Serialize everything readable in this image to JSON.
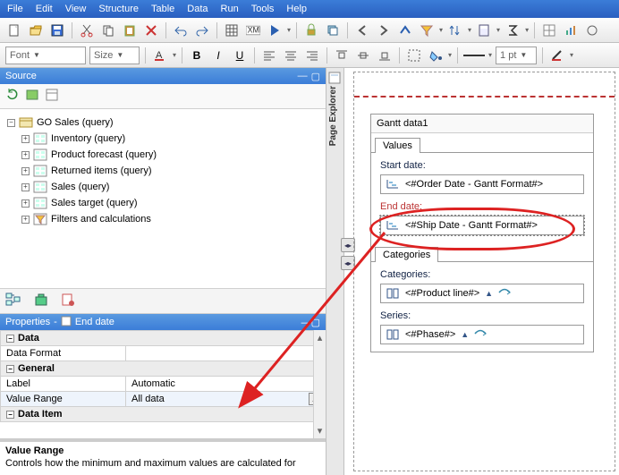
{
  "menu": {
    "file": "File",
    "edit": "Edit",
    "view": "View",
    "structure": "Structure",
    "table": "Table",
    "data": "Data",
    "run": "Run",
    "tools": "Tools",
    "help": "Help"
  },
  "toolbar2": {
    "font": "Font",
    "size": "Size",
    "pt": "1 pt"
  },
  "source": {
    "title": "Source",
    "root": "GO Sales (query)",
    "items": [
      "Inventory (query)",
      "Product forecast (query)",
      "Returned items (query)",
      "Sales (query)",
      "Sales target (query)",
      "Filters and calculations"
    ]
  },
  "props": {
    "title": "Properties",
    "subject": "End date",
    "cat_data": "Data",
    "data_format_k": "Data Format",
    "cat_general": "General",
    "label_k": "Label",
    "label_v": "Automatic",
    "valuerange_k": "Value Range",
    "valuerange_v": "All data",
    "cat_dataitem": "Data Item",
    "desc_title": "Value Range",
    "desc_body": "Controls how the minimum and maximum values are calculated for"
  },
  "right": {
    "page_explorer": "Page Explorer",
    "gantt_title": "Gantt data1",
    "tab_values": "Values",
    "start_label": "Start date:",
    "start_val": "<#Order Date - Gantt Format#>",
    "end_label": "End date:",
    "end_val": "<#Ship Date - Gantt Format#>",
    "tab_categories": "Categories",
    "categories_label": "Categories:",
    "categories_val": "<#Product line#>",
    "series_label": "Series:",
    "series_val": "<#Phase#>"
  }
}
